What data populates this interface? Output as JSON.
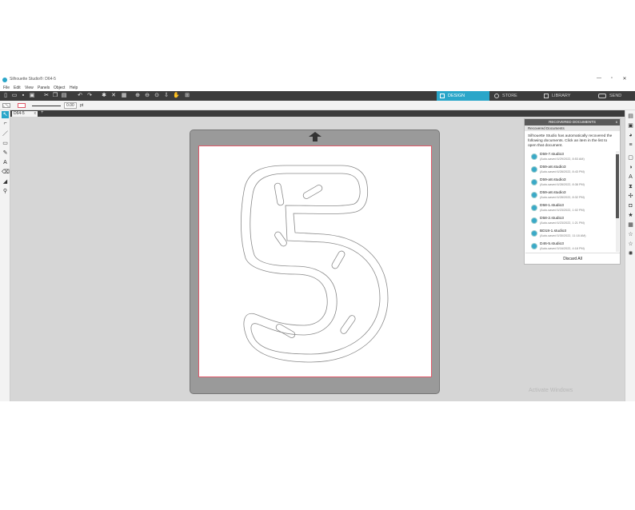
{
  "window": {
    "title": "Silhouette Studio®: D64-5",
    "controls": [
      "—",
      "▫",
      "✕"
    ]
  },
  "menu": [
    "File",
    "Edit",
    "View",
    "Panels",
    "Object",
    "Help"
  ],
  "tabs": [
    {
      "label": "DESIGN",
      "active": true
    },
    {
      "label": "STORE",
      "active": false
    },
    {
      "label": "LIBRARY",
      "active": false
    },
    {
      "label": "SEND",
      "active": false
    }
  ],
  "stylebar": {
    "line_width": "0.00",
    "unit": "pt"
  },
  "document_tab": {
    "name": "D64-5",
    "close": "x",
    "add": "+"
  },
  "recovered": {
    "header": "RECOVERED DOCUMENTS",
    "close": "x",
    "subheader": "Recovered Documents",
    "message": "Silhouette Studio has automatically recovered the following documents. Click an item in the list to open that document.",
    "items": [
      {
        "name": "D59-7.studio3",
        "saved": "(Auto-saved 6/29/2022, 8:53 AM)"
      },
      {
        "name": "D59-a8.studio3",
        "saved": "(Auto-saved 6/28/2022, 8:43 PM)"
      },
      {
        "name": "D59-a8.studio3",
        "saved": "(Auto-saved 6/28/2022, 8:38 PM)"
      },
      {
        "name": "D59-a8.studio3",
        "saved": "(Auto-saved 6/28/2022, 8:32 PM)"
      },
      {
        "name": "D58-1.studio3",
        "saved": "(Auto-saved 6/23/2022, 1:02 PM)"
      },
      {
        "name": "D58-2.studio3",
        "saved": "(Auto-saved 6/23/2022, 1:21 PM)"
      },
      {
        "name": "BD18-1.studio3",
        "saved": "(Auto-saved 5/30/2022, 11:18 AM)"
      },
      {
        "name": "D46-5.studio3",
        "saved": "(Auto-saved 5/16/2022, 4:18 PM)"
      }
    ],
    "discard_label": "Discard All"
  },
  "watermark": "Activate Windows",
  "colors": {
    "accent": "#2aa6c9",
    "toolbar": "#3c3c3c",
    "workspace": "#d6d6d6",
    "mat": "#9a9a9a",
    "page_border": "#e05a6a"
  }
}
